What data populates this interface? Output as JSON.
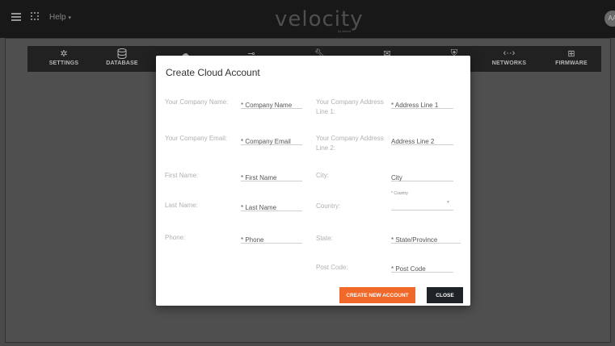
{
  "topbar": {
    "help_label": "Help",
    "logo_text": "velocity",
    "logo_sub": "by atlona",
    "avatar_initials": "AA"
  },
  "nav": {
    "items": [
      {
        "label": "SETTINGS",
        "icon": "gear-icon"
      },
      {
        "label": "DATABASE",
        "icon": "database-icon"
      },
      {
        "label": "",
        "icon": "cloud-icon"
      },
      {
        "label": "",
        "icon": "key-icon"
      },
      {
        "label": "",
        "icon": "wrench-icon"
      },
      {
        "label": "",
        "icon": "mail-icon"
      },
      {
        "label": "",
        "icon": "shield-icon"
      },
      {
        "label": "NETWORKS",
        "icon": "network-icon"
      },
      {
        "label": "FIRMWARE",
        "icon": "firmware-icon"
      }
    ]
  },
  "modal": {
    "title": "Create Cloud Account",
    "left_fields": [
      {
        "label": "Your Company Name:",
        "placeholder": "* Company Name"
      },
      {
        "label": "Your Company Email:",
        "placeholder": "* Company Email"
      },
      {
        "label": "First Name:",
        "placeholder": "* First Name"
      },
      {
        "label": "Last Name:",
        "placeholder": "* Last Name"
      },
      {
        "label": "Phone:",
        "placeholder": "* Phone"
      }
    ],
    "right_fields": [
      {
        "label": "Your Company Address Line 1:",
        "placeholder": "* Address Line 1"
      },
      {
        "label": "Your Company Address Line 2:",
        "placeholder": "Address Line 2"
      },
      {
        "label": "City:",
        "placeholder": "City"
      },
      {
        "label": "Country:",
        "caption": "* Country",
        "value": ""
      },
      {
        "label": "State:",
        "placeholder": "* State/Province"
      },
      {
        "label": "Post Code:",
        "placeholder": "* Post Code"
      }
    ],
    "create_button": "CREATE NEW ACCOUNT",
    "close_button": "CLOSE"
  }
}
